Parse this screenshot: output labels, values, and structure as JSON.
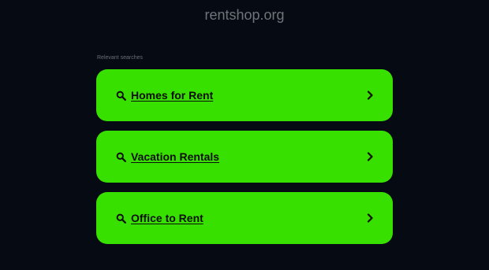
{
  "header": {
    "site_title": "rentshop.org"
  },
  "section": {
    "label": "Relevant searches"
  },
  "results": [
    {
      "label": "Homes for Rent",
      "icon": "search-icon",
      "trailing_icon": "chevron-right-icon"
    },
    {
      "label": "Vacation Rentals",
      "icon": "search-icon",
      "trailing_icon": "chevron-right-icon"
    },
    {
      "label": "Office to Rent",
      "icon": "search-icon",
      "trailing_icon": "chevron-right-icon"
    }
  ],
  "colors": {
    "background": "#060b13",
    "card": "#38e000",
    "card_text": "#0b0f0b",
    "muted_text": "#6f747a"
  }
}
